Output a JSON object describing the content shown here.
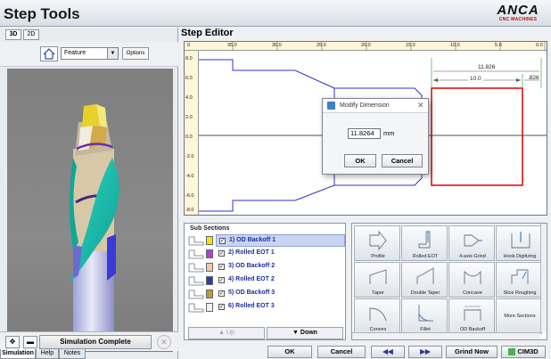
{
  "app": {
    "title": "Step Tools",
    "logo": "ANCA",
    "logo_sub": "CNC MACHINES"
  },
  "left_panel": {
    "view_tabs": [
      {
        "label": "3D",
        "active": true
      },
      {
        "label": "2D",
        "active": false
      }
    ],
    "view_select": "Feature",
    "options_label": "Options",
    "simulation_status": "Simulation Complete",
    "bottom_tabs": [
      {
        "label": "Simulation",
        "active": true
      },
      {
        "label": "Help",
        "active": false
      },
      {
        "label": "Notes",
        "active": false
      }
    ]
  },
  "editor": {
    "title": "Step Editor",
    "ruler_top": [
      "0",
      "35.0",
      "30.0",
      "25.0",
      "20.0",
      "15.0",
      "10.0",
      "5.0",
      "0.0"
    ],
    "ruler_left": [
      "8.0",
      "6.0",
      "4.0",
      "2.0",
      "0.0",
      "-2.0",
      "-4.0",
      "-6.0",
      "-8.0"
    ],
    "dimensions": {
      "upper": "11.826",
      "lower": "10.0",
      "side": ".826"
    }
  },
  "modal": {
    "title": "Modify Dimension",
    "value": "11.8264",
    "unit": "mm",
    "ok_label": "OK",
    "cancel_label": "Cancel"
  },
  "sub_sections": {
    "title": "Sub Sections",
    "items": [
      {
        "label": "1) OD Backoff 1",
        "color": "#f2e600",
        "selected": true
      },
      {
        "label": "2) Rolled EOT 1",
        "color": "#b03fd6",
        "selected": false
      },
      {
        "label": "3) OD Backoff 2",
        "color": "#f3c9a8",
        "selected": false
      },
      {
        "label": "4) Rolled EOT 2",
        "color": "#2a3f9a",
        "selected": false
      },
      {
        "label": "5) OD Backoff 3",
        "color": "#b89a40",
        "selected": false
      },
      {
        "label": "6) Rolled EOT 3",
        "color": "#f2f2f2",
        "selected": false
      }
    ],
    "up_label": "Up",
    "down_label": "Down"
  },
  "features": [
    {
      "label": "Profile",
      "icon": "profile-icon"
    },
    {
      "label": "Rolled EOT",
      "icon": "rolled-eot-icon"
    },
    {
      "label": "4-axis Grind",
      "icon": "four-axis-grind-icon"
    },
    {
      "label": "Hook Digitizing",
      "icon": "hook-digitizing-icon"
    },
    {
      "label": "Taper",
      "icon": "taper-icon"
    },
    {
      "label": "Double Taper",
      "icon": "double-taper-icon"
    },
    {
      "label": "Concave",
      "icon": "concave-icon"
    },
    {
      "label": "Slice Roughing",
      "icon": "slice-roughing-icon"
    },
    {
      "label": "Convex",
      "icon": "convex-icon"
    },
    {
      "label": "Fillet",
      "icon": "fillet-icon"
    },
    {
      "label": "OD Backoff",
      "icon": "od-backoff-icon"
    },
    {
      "label": "More Sections",
      "icon": "more-sections-icon"
    }
  ],
  "actions": {
    "ok": "OK",
    "cancel": "Cancel",
    "prev": "◀◀",
    "next": "▶▶",
    "grind_now": "Grind Now",
    "cim3d": "CIM3D"
  }
}
